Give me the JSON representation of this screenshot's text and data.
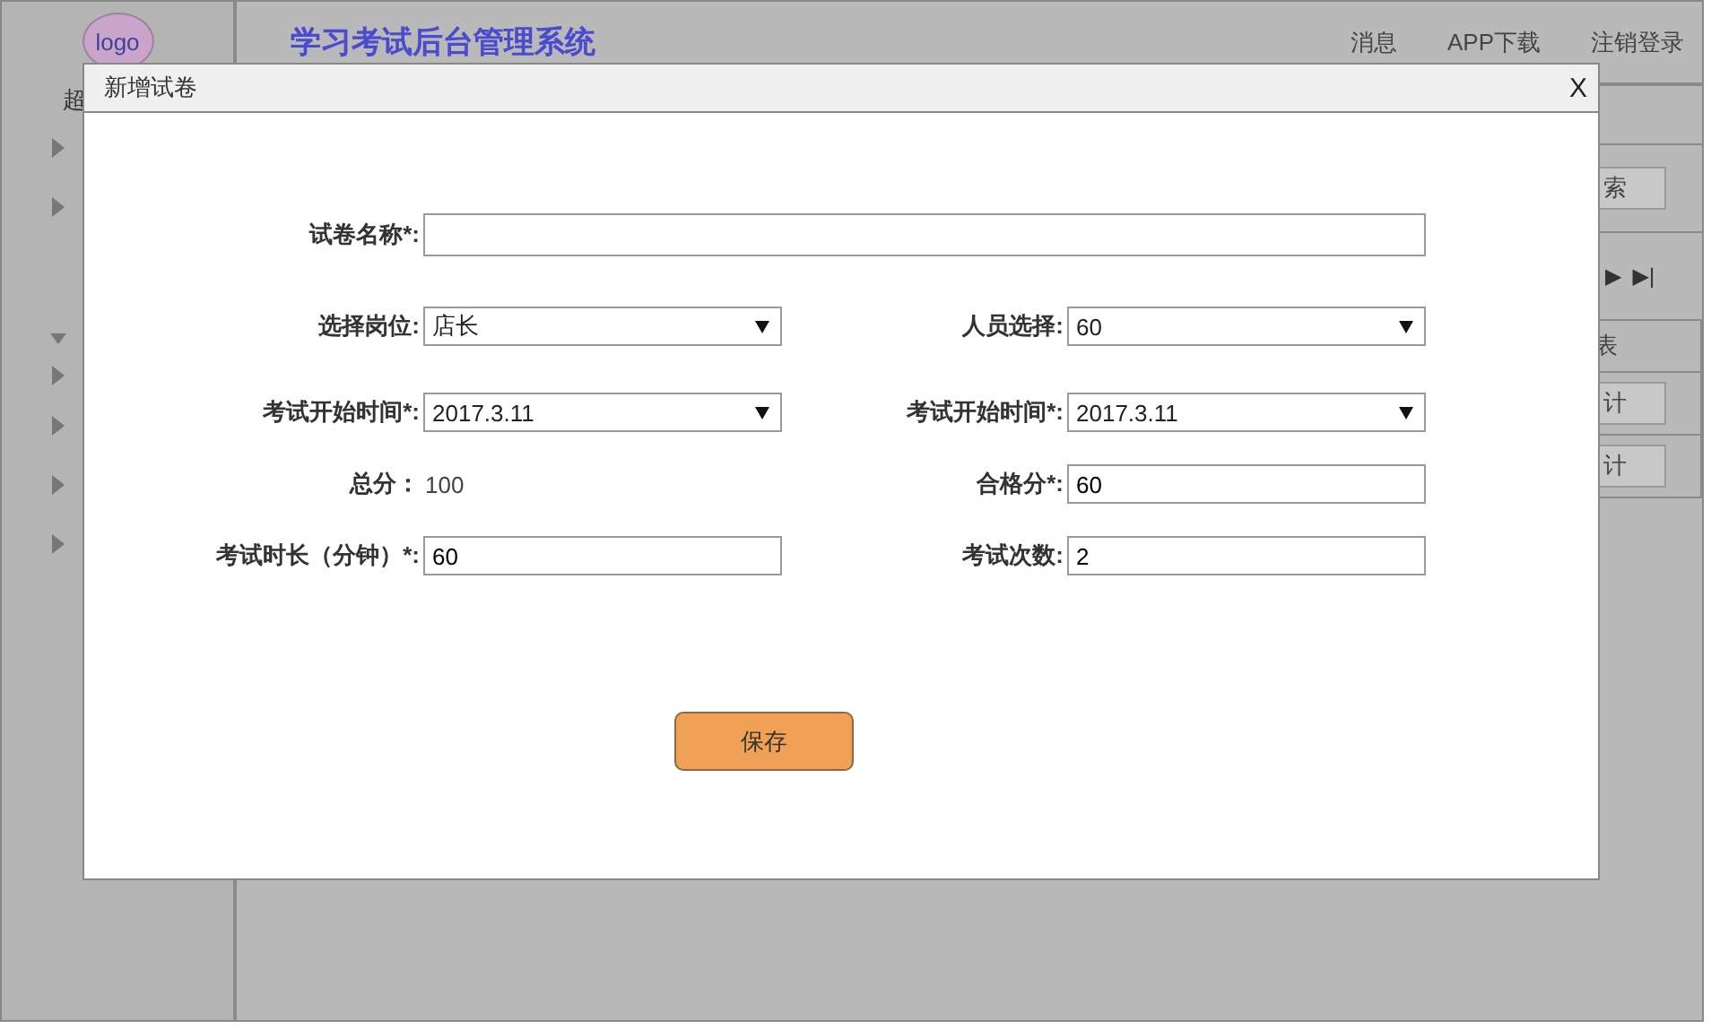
{
  "sidebar": {
    "logo": "logo",
    "user_label": "超",
    "items": [
      {
        "expanded": false
      },
      {
        "expanded": false
      },
      {
        "expanded": true
      },
      {
        "expanded": false
      },
      {
        "expanded": false
      },
      {
        "expanded": false
      },
      {
        "expanded": false
      }
    ]
  },
  "header": {
    "title": "学习考试后台管理系统",
    "nav": [
      "消息",
      "APP下载",
      "注销登录"
    ]
  },
  "background": {
    "search_button": "索",
    "pager": [
      "▶",
      "▶|"
    ],
    "table_header": "表",
    "row_buttons": [
      "计",
      "计"
    ]
  },
  "dialog": {
    "title": "新增试卷",
    "close": "X",
    "rows": [
      [
        {
          "label": "试卷名称*:",
          "kind": "text",
          "wide": true
        }
      ],
      [
        {
          "label": "选择岗位:",
          "kind": "select",
          "value": "店长"
        },
        {
          "label": "人员选择:",
          "kind": "select",
          "value": "60"
        }
      ],
      [
        {
          "label": "考试开始时间*:",
          "kind": "select",
          "value": "2017.3.11"
        },
        {
          "label": "考试开始时间*:",
          "kind": "select",
          "value": "2017.3.11"
        }
      ],
      [
        {
          "label": "总分：",
          "kind": "static",
          "value": "100"
        },
        {
          "label": "合格分*:",
          "kind": "text",
          "value": "60"
        }
      ],
      [
        {
          "label": "考试时长（分钟）*:",
          "kind": "text",
          "value": "60"
        },
        {
          "label": "考试次数:",
          "kind": "text",
          "value": "2"
        }
      ]
    ],
    "save_button": "保存"
  }
}
